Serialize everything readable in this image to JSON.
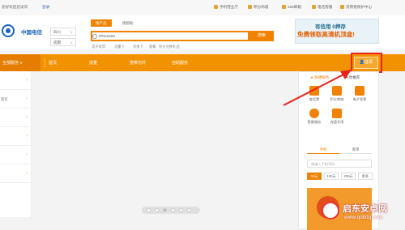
{
  "topbar": {
    "left_text": "您好欢迎您访问",
    "login_link": "登录",
    "items": [
      "手机营业厅",
      "积分商城",
      "189邮箱",
      "电话客服",
      "消费者保护中心"
    ]
  },
  "header": {
    "logo_text": "中国电信",
    "province": "四川",
    "city": "成都",
    "search_tabs": [
      "搜产品",
      "搜帮助"
    ],
    "search_value": "iPhone6s",
    "search_button": "搜索",
    "hot_words": [
      "电子发票",
      "流量卡",
      "充值卡",
      "套餐",
      "积分兑换礼品"
    ]
  },
  "promo": {
    "line1": "有信用 0押存",
    "line2": "免费领取高清机顶盒!"
  },
  "nav": {
    "left_category": "全部服务 ∨",
    "items": [
      "首页",
      "流量",
      "宽带光纤",
      "自助服务"
    ],
    "login_button": "登录"
  },
  "sidebar": {
    "rows": [
      "",
      "话号",
      "",
      "",
      "",
      ""
    ]
  },
  "right_panel": {
    "tabs": [
      "★ 快捷服务",
      "♥ 你推荐"
    ],
    "services": [
      {
        "label": "查话费"
      },
      {
        "label": "积分商城"
      },
      {
        "label": "电子发票"
      },
      {
        "label": "套餐服务"
      },
      {
        "label": "充值专用"
      }
    ],
    "segments": [
      "手机",
      "宽带"
    ],
    "phone_placeholder": "请输入手机号码",
    "amounts": [
      "50元",
      "100元",
      "200元",
      "更多"
    ]
  },
  "carousel": {
    "dots": 6,
    "active_index": 2
  },
  "watermark": {
    "title": "启东安卓网",
    "url": "www.qdltdq.com"
  },
  "colors": {
    "accent": "#f39200",
    "highlight": "#e8231b",
    "brand_blue": "#1b63b8"
  }
}
